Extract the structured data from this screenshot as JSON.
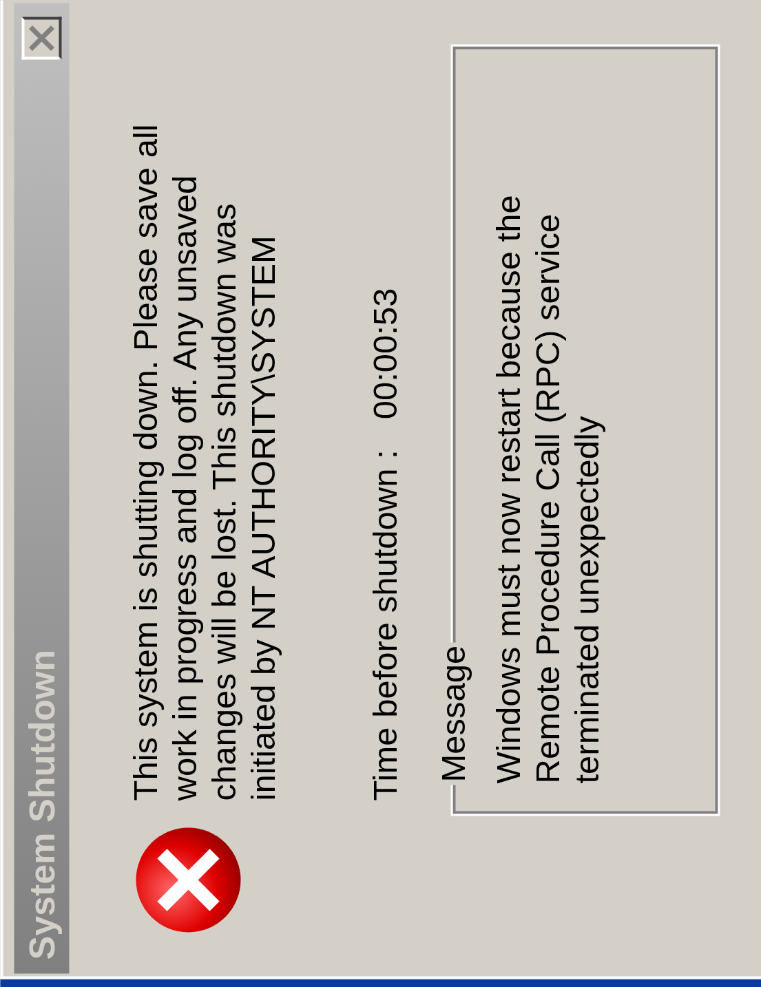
{
  "window": {
    "title": "System Shutdown"
  },
  "message_lines": [
    "This system is shutting down. Please save all",
    "work in progress and log off. Any unsaved",
    "changes will be lost. This shutdown was",
    "initiated by NT AUTHORITY\\SYSTEM"
  ],
  "countdown": {
    "label": "Time before shutdown :",
    "value": "00:00:53"
  },
  "message_group": {
    "legend": "Message",
    "lines": [
      "Windows must now restart because the",
      "Remote Procedure Call (RPC) service",
      "terminated unexpectedly"
    ]
  }
}
